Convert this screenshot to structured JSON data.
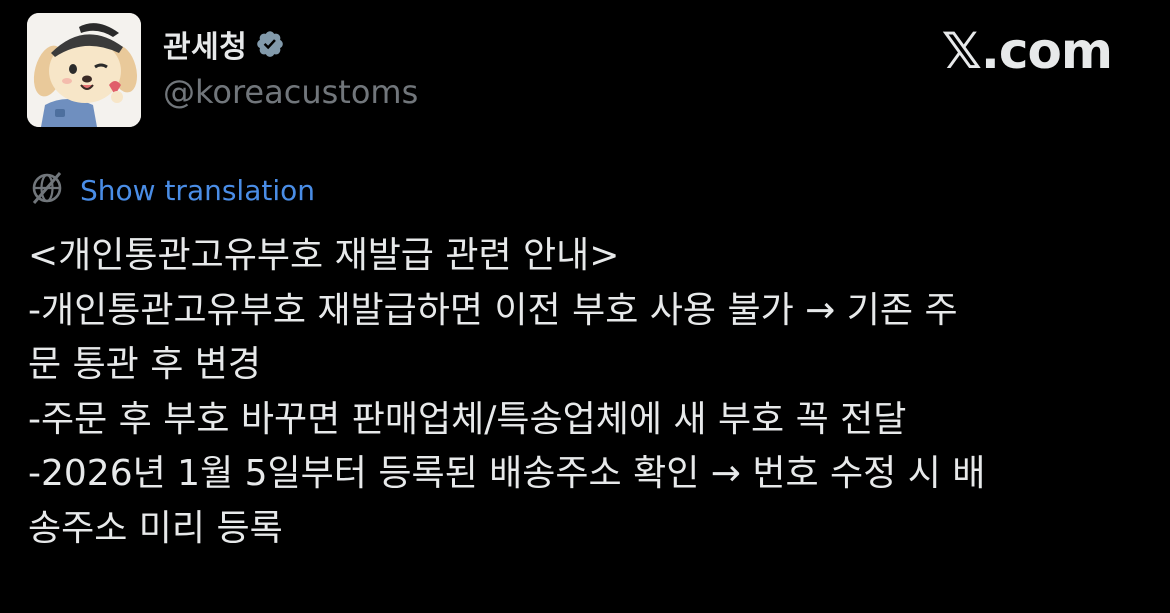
{
  "author": {
    "display_name": "관세청",
    "handle": "@koreacustoms",
    "verified": true
  },
  "brand": {
    "label": "𝕏.com"
  },
  "translation": {
    "label": "Show translation"
  },
  "tweet": {
    "lines": [
      "<개인통관고유부호 재발급 관련 안내>",
      "-개인통관고유부호 재발급하면 이전 부호 사용 불가 → 기존 주",
      "문 통관 후 변경",
      "-주문 후 부호 바꾸면 판매업체/특송업체에 새 부호 꼭 전달",
      "-2026년 1월 5일부터 등록된 배송주소 확인 → 번호 수정 시 배",
      "송주소 미리 등록"
    ]
  },
  "colors": {
    "background": "#000000",
    "text": "#e7e9ea",
    "secondary": "#71767b",
    "link": "#4a8de6",
    "verified_badge": "#829aab"
  },
  "icons": {
    "verified": "verified-badge-icon",
    "translate": "globe-icon",
    "avatar": "puppy-character-avatar"
  }
}
